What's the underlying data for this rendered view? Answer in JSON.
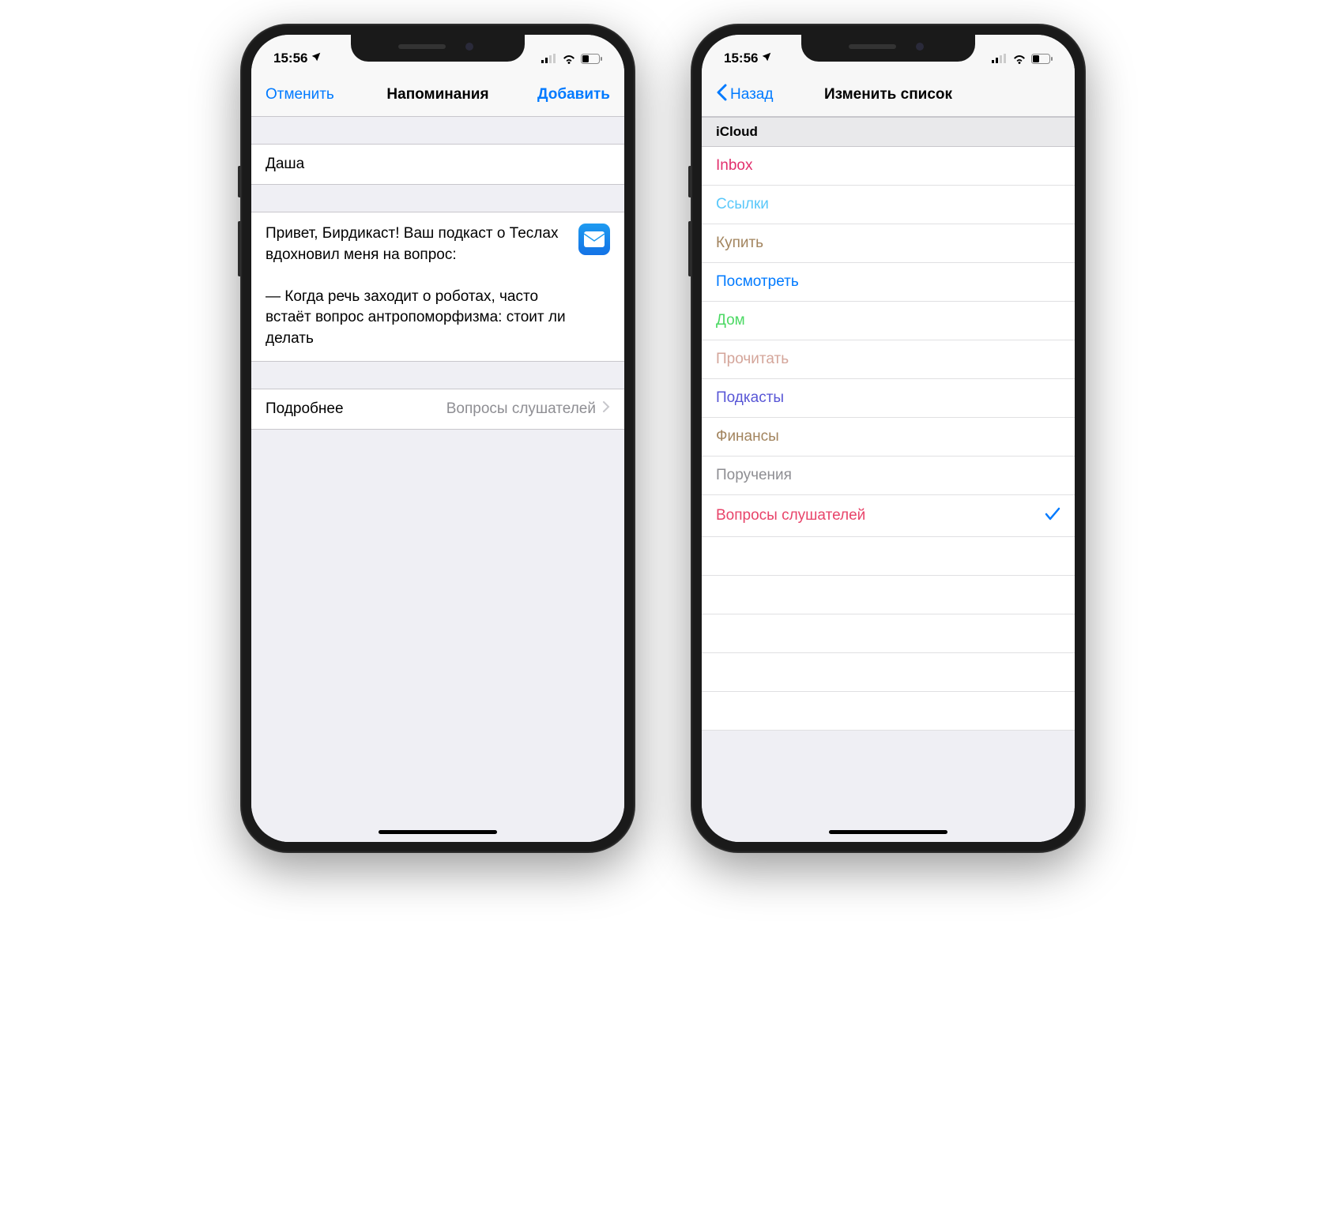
{
  "status": {
    "time": "15:56"
  },
  "screen1": {
    "nav": {
      "cancel": "Отменить",
      "title": "Напоминания",
      "add": "Добавить"
    },
    "title_field": "Даша",
    "note_text": "Привет, Бирдикаст! Ваш подкаст о Теслах вдохновил меня на вопрос:\n\n— Когда речь заходит о роботах, часто встаёт вопрос антропоморфизма: стоит ли делать",
    "details": {
      "label": "Подробнее",
      "value": "Вопросы слушателей"
    },
    "mail_icon_name": "mail-icon"
  },
  "screen2": {
    "nav": {
      "back": "Назад",
      "title": "Изменить список"
    },
    "section_header": "iCloud",
    "lists": [
      {
        "label": "Inbox",
        "color": "#e2306d",
        "selected": false
      },
      {
        "label": "Ссылки",
        "color": "#5ac8fa",
        "selected": false
      },
      {
        "label": "Купить",
        "color": "#a2845e",
        "selected": false
      },
      {
        "label": "Посмотреть",
        "color": "#007aff",
        "selected": false
      },
      {
        "label": "Дом",
        "color": "#4cd964",
        "selected": false
      },
      {
        "label": "Прочитать",
        "color": "#d4a59a",
        "selected": false
      },
      {
        "label": "Подкасты",
        "color": "#5856d6",
        "selected": false
      },
      {
        "label": "Финансы",
        "color": "#a2845e",
        "selected": false
      },
      {
        "label": "Поручения",
        "color": "#8e8e93",
        "selected": false
      },
      {
        "label": "Вопросы слушателей",
        "color": "#e8446a",
        "selected": true
      }
    ]
  }
}
